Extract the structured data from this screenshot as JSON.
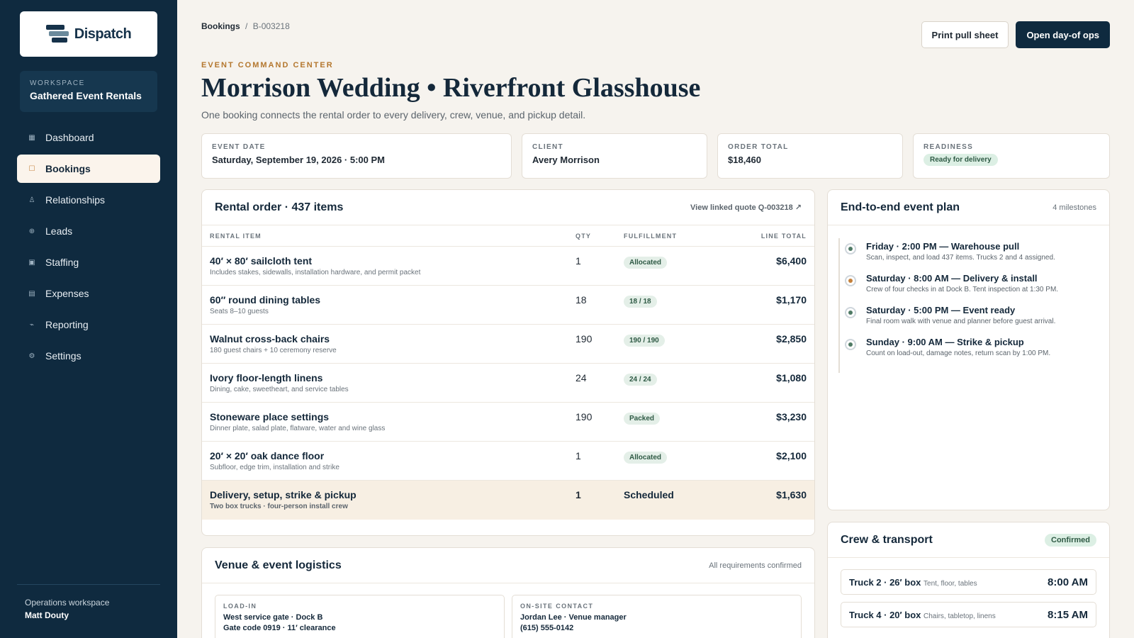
{
  "app": {
    "name": "Dispatch"
  },
  "workspace": {
    "label": "WORKSPACE",
    "name": "Gathered Event Rentals"
  },
  "nav": [
    {
      "label": "Dashboard",
      "icon": "grid-icon",
      "active": false
    },
    {
      "label": "Bookings",
      "icon": "calendar-icon",
      "active": true
    },
    {
      "label": "Relationships",
      "icon": "people-icon",
      "active": false
    },
    {
      "label": "Leads",
      "icon": "target-icon",
      "active": false
    },
    {
      "label": "Staffing",
      "icon": "badge-icon",
      "active": false
    },
    {
      "label": "Expenses",
      "icon": "receipt-icon",
      "active": false
    },
    {
      "label": "Reporting",
      "icon": "chart-icon",
      "active": false
    },
    {
      "label": "Settings",
      "icon": "gear-icon",
      "active": false
    }
  ],
  "footer": {
    "label": "Operations workspace",
    "user": "Matt Douty"
  },
  "breadcrumb": {
    "root": "Bookings",
    "separator": "/",
    "current": "B-003218"
  },
  "actions": {
    "print": "Print pull sheet",
    "open_ops": "Open day-of ops"
  },
  "header": {
    "eyebrow": "EVENT COMMAND CENTER",
    "title": "Morrison Wedding • Riverfront Glasshouse",
    "subtitle": "One booking connects the rental order to every delivery, crew, venue, and pickup detail."
  },
  "stats": {
    "event_date": {
      "label": "EVENT DATE",
      "value": "Saturday, September 19, 2026 · 5:00 PM"
    },
    "client": {
      "label": "CLIENT",
      "value": "Avery Morrison"
    },
    "order_total": {
      "label": "ORDER TOTAL",
      "value": "$18,460"
    },
    "readiness": {
      "label": "READINESS",
      "value": "Ready for delivery"
    }
  },
  "rental_order": {
    "title": "Rental order · 437 items",
    "link": "View linked quote Q-003218 ↗",
    "columns": {
      "item": "RENTAL ITEM",
      "qty": "QTY",
      "fulfillment": "FULFILLMENT",
      "total": "LINE TOTAL"
    },
    "rows": [
      {
        "name": "40′ × 80′ sailcloth tent",
        "desc": "Includes stakes, sidewalls, installation hardware, and permit packet",
        "qty": "1",
        "fulfillment": "Allocated",
        "total": "$6,400"
      },
      {
        "name": "60″ round dining tables",
        "desc": "Seats 8–10 guests",
        "qty": "18",
        "fulfillment": "18 / 18",
        "total": "$1,170"
      },
      {
        "name": "Walnut cross-back chairs",
        "desc": "180 guest chairs + 10 ceremony reserve",
        "qty": "190",
        "fulfillment": "190 / 190",
        "total": "$2,850"
      },
      {
        "name": "Ivory floor-length linens",
        "desc": "Dining, cake, sweetheart, and service tables",
        "qty": "24",
        "fulfillment": "24 / 24",
        "total": "$1,080"
      },
      {
        "name": "Stoneware place settings",
        "desc": "Dinner plate, salad plate, flatware, water and wine glass",
        "qty": "190",
        "fulfillment": "Packed",
        "total": "$3,230"
      },
      {
        "name": "20′ × 20′ oak dance floor",
        "desc": "Subfloor, edge trim, installation and strike",
        "qty": "1",
        "fulfillment": "Allocated",
        "total": "$2,100"
      }
    ],
    "service_row": {
      "name": "Delivery, setup, strike & pickup",
      "desc": "Two box trucks · four-person install crew",
      "qty": "1",
      "fulfillment": "Scheduled",
      "total": "$1,630"
    }
  },
  "plan": {
    "title": "End-to-end event plan",
    "meta": "4 milestones",
    "milestones": [
      {
        "title": "Friday · 2:00 PM — Warehouse pull",
        "desc": "Scan, inspect, and load 437 items. Trucks 2 and 4 assigned.",
        "color": "#4f7a65"
      },
      {
        "title": "Saturday · 8:00 AM — Delivery & install",
        "desc": "Crew of four checks in at Dock B. Tent inspection at 1:30 PM.",
        "color": "#c4813b"
      },
      {
        "title": "Saturday · 5:00 PM — Event ready",
        "desc": "Final room walk with venue and planner before guest arrival.",
        "color": "#4f7a65"
      },
      {
        "title": "Sunday · 9:00 AM — Strike & pickup",
        "desc": "Count on load-out, damage notes, return scan by 1:00 PM.",
        "color": "#4f7a65"
      }
    ]
  },
  "crew": {
    "title": "Crew & transport",
    "status": "Confirmed",
    "trucks": [
      {
        "name": "Truck 2 · 26′ box",
        "note": "Tent, floor, tables",
        "time": "8:00 AM"
      },
      {
        "name": "Truck 4 · 20′ box",
        "note": "Chairs, tabletop, linens",
        "time": "8:15 AM"
      }
    ]
  },
  "venue": {
    "title": "Venue & event logistics",
    "meta": "All requirements confirmed",
    "load_in": {
      "label": "LOAD-IN",
      "line1": "West service gate · Dock B",
      "line2": "Gate code 0919 · 11′ clearance"
    },
    "contact": {
      "label": "ON-SITE CONTACT",
      "line1": "Jordan Lee · Venue manager",
      "line2": "(615) 555-0142"
    }
  }
}
